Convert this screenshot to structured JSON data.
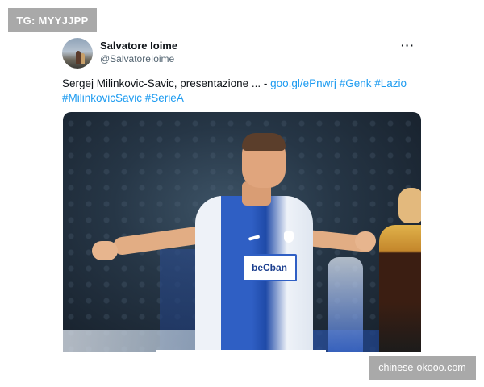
{
  "watermarks": {
    "top_left": "TG: MYYJJPP",
    "bottom_right": "chinese-okooo.com"
  },
  "tweet": {
    "author_name": "Salvatore Ioime",
    "author_handle": "@SalvatoreIoime",
    "more_icon": "more-horizontal-icon",
    "text_plain": "Sergej Milinkovic-Savic, presentazione ... - ",
    "link": "goo.gl/ePnwrj",
    "hashtags": [
      "#Genk",
      "#Lazio",
      "#MilinkovicSavic",
      "#SerieA"
    ],
    "image": {
      "sponsor_text": "beCban"
    }
  },
  "colors": {
    "link": "#1d9bf0",
    "text": "#0f1419",
    "muted": "#536471",
    "watermark_bg": "#a9a9a9"
  }
}
